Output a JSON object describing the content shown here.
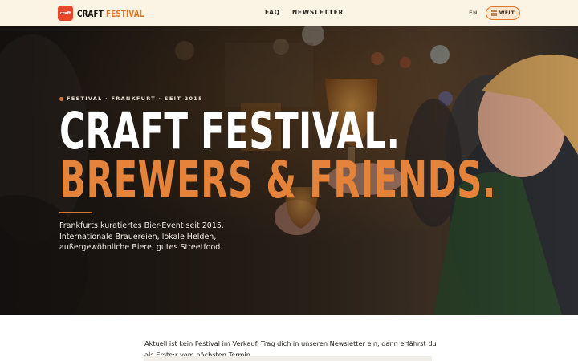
{
  "header": {
    "logo": {
      "badge_text": "craft",
      "word1": "CRAFT",
      "word2": "FESTIVAL"
    },
    "nav": [
      {
        "label": "FAQ"
      },
      {
        "label": "NEWSLETTER"
      }
    ],
    "language": "EN",
    "world_button": {
      "label": "WELT",
      "icon": "grid-icon"
    }
  },
  "hero": {
    "eyebrow": "FESTIVAL · FRANKFURT · SEIT 2015",
    "headline_line1": "CRAFT FESTIVAL.",
    "headline_line2": "BREWERS & FRIENDS.",
    "lede": "Frankfurts kuratiertes Bier-Event seit 2015. Internationale Brauereien, lokale Helden, außergewöhnliche Biere, gutes Streetfood."
  },
  "notice": {
    "text": "Aktuell ist kein Festival im Verkauf. Trag dich in unseren Newsletter ein, dann erfährst du als Erste:r vom nächsten Termin."
  },
  "colors": {
    "accent": "#e0782b",
    "header_bg": "#fbf3e3",
    "logo_badge": "#e8452b"
  }
}
